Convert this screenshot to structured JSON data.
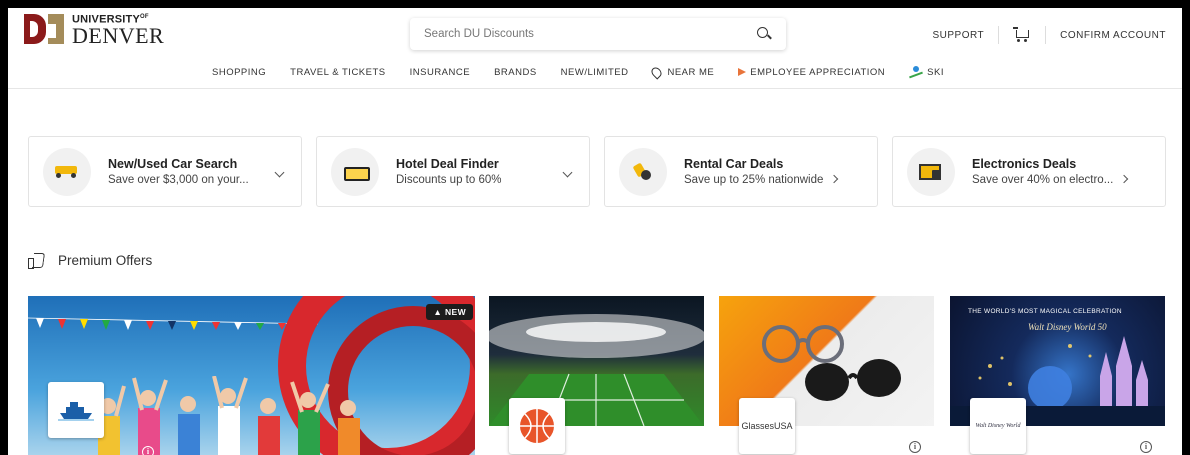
{
  "header": {
    "logo_line1": "UNIVERSITY",
    "logo_line1_sup": "OF",
    "logo_line2": "DENVER",
    "search_placeholder": "Search DU Discounts",
    "support": "SUPPORT",
    "confirm_account": "CONFIRM ACCOUNT"
  },
  "nav": {
    "items": [
      "SHOPPING",
      "TRAVEL & TICKETS",
      "INSURANCE",
      "BRANDS",
      "NEW/LIMITED",
      "NEAR ME",
      "EMPLOYEE APPRECIATION",
      "SKI"
    ]
  },
  "quick_cards": [
    {
      "title": "New/Used Car Search",
      "subtitle": "Save over $3,000 on your...",
      "icon": "jeep-icon"
    },
    {
      "title": "Hotel Deal Finder",
      "subtitle": "Discounts up to 60%",
      "icon": "bed-icon"
    },
    {
      "title": "Rental Car Deals",
      "subtitle": "Save up to 25% nationwide",
      "icon": "car-keys-icon"
    },
    {
      "title": "Electronics Deals",
      "subtitle": "Save over 40% on electro...",
      "icon": "electronics-icon"
    }
  ],
  "premium": {
    "heading": "Premium Offers"
  },
  "offers": {
    "new_badge": "NEW",
    "glasses_logo": "GlassesUSA",
    "disney_caption": "THE WORLD'S MOST MAGICAL CELEBRATION",
    "disney_logo": "Walt Disney World 50",
    "disney_small_logo": "Walt Disney World"
  },
  "colors": {
    "brand_red": "#8b1a1a",
    "brand_gold": "#a48c5a",
    "accent_orange": "#e8743b"
  }
}
